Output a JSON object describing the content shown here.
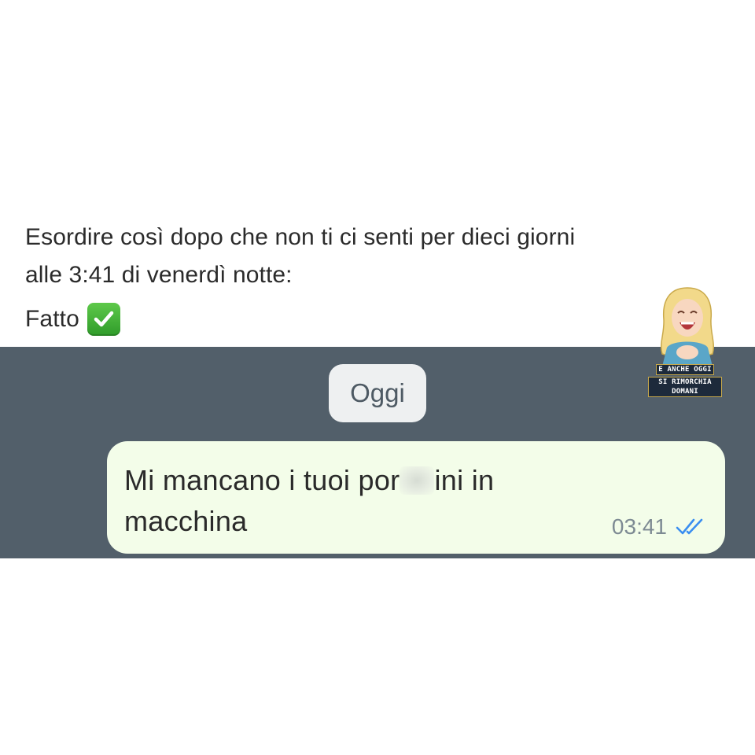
{
  "caption": {
    "line1": "Esordire così dopo che non ti ci senti per dieci giorni",
    "line2": "alle 3:41 di venerdì notte:",
    "line3": "Fatto",
    "emoji": "check-mark-button"
  },
  "chat": {
    "date_pill": "Oggi",
    "message": {
      "text_before": "Mi mancano i tuoi por",
      "text_after": "ini in",
      "text_line2": "macchina",
      "time": "03:41",
      "status": "read"
    },
    "background_color": "#525f6a",
    "bubble_color": "#f3fde9",
    "tick_color": "#3a8ef0"
  },
  "watermark": {
    "line1": "E ANCHE OGGI",
    "line2": "SI RIMORCHIA DOMANI"
  }
}
